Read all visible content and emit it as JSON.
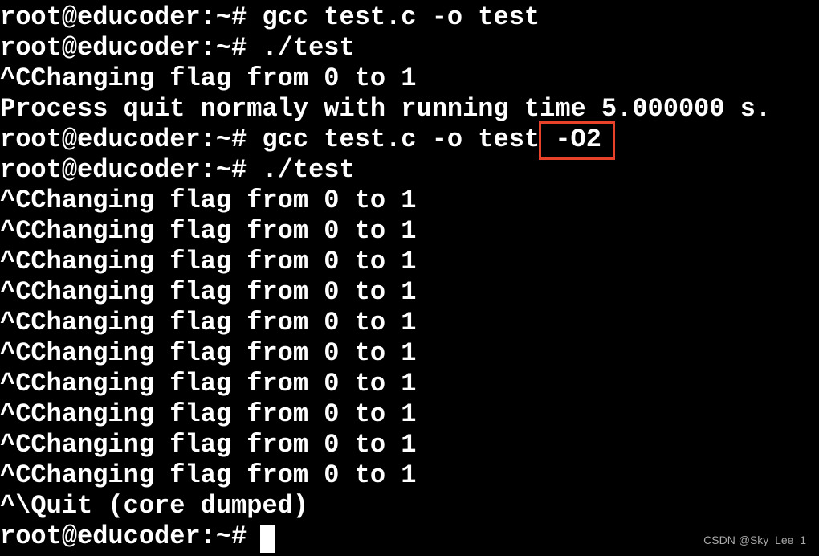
{
  "terminal": {
    "lines": [
      "root@educoder:~# gcc test.c -o test",
      "root@educoder:~# ./test",
      "^CChanging flag from 0 to 1",
      "Process quit normaly with running time 5.000000 s.",
      "root@educoder:~# gcc test.c -o test -O2",
      "root@educoder:~# ./test",
      "^CChanging flag from 0 to 1",
      "^CChanging flag from 0 to 1",
      "^CChanging flag from 0 to 1",
      "^CChanging flag from 0 to 1",
      "^CChanging flag from 0 to 1",
      "^CChanging flag from 0 to 1",
      "^CChanging flag from 0 to 1",
      "^CChanging flag from 0 to 1",
      "^CChanging flag from 0 to 1",
      "^CChanging flag from 0 to 1",
      "^\\Quit (core dumped)",
      "root@educoder:~# "
    ],
    "highlighted_text": "-O2",
    "highlight_color": "#e8432a",
    "background_color": "#000000",
    "text_color": "#ffffff"
  },
  "watermark": "CSDN @Sky_Lee_1"
}
